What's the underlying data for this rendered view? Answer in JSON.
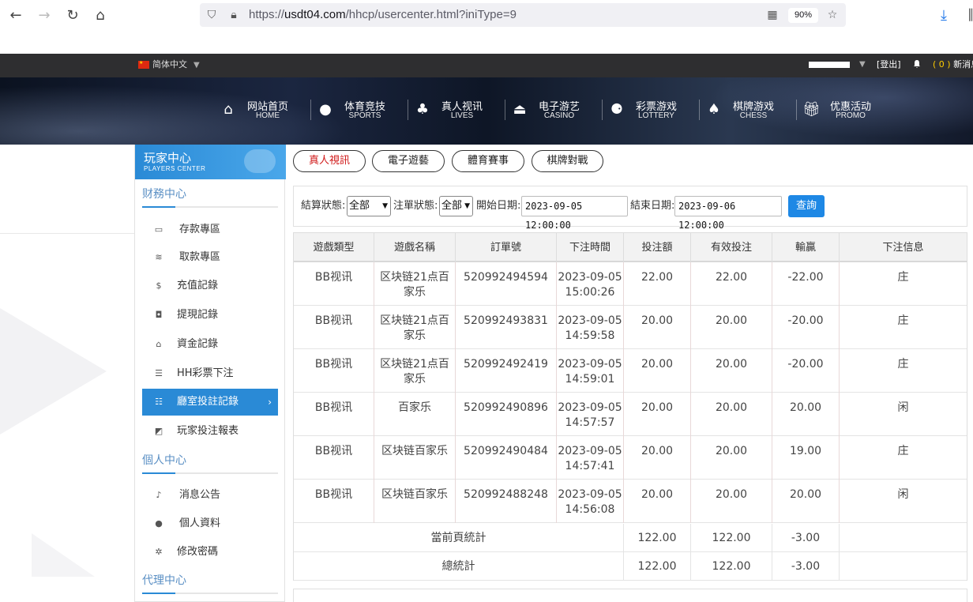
{
  "browser": {
    "url_prefix": "https://",
    "url_domain": "usdt04.com",
    "url_path": "/hhcp/usercenter.html?iniType=9",
    "zoom": "90%"
  },
  "topbar": {
    "language": "简体中文",
    "logout": "[登出]",
    "msg_count": "( 0 )",
    "msg_label": "新消息"
  },
  "nav": [
    {
      "cn": "网站首页",
      "en": "HOME",
      "icon": "home-icon"
    },
    {
      "cn": "体育竞技",
      "en": "SPORTS",
      "icon": "ball-icon"
    },
    {
      "cn": "真人视讯",
      "en": "LIVES",
      "icon": "cards-icon"
    },
    {
      "cn": "电子游艺",
      "en": "CASINO",
      "icon": "joystick-icon"
    },
    {
      "cn": "彩票游戏",
      "en": "LOTTERY",
      "icon": "lottery-balls-icon"
    },
    {
      "cn": "棋牌游戏",
      "en": "CHESS",
      "icon": "spade-icon"
    },
    {
      "cn": "优惠活动",
      "en": "PROMO",
      "icon": "gift-icon"
    }
  ],
  "sidebar": {
    "title": "玩家中心",
    "subtitle": "PLAYERS CENTER",
    "sections": [
      {
        "title": "财務中心"
      },
      {
        "title": "個人中心"
      },
      {
        "title": "代理中心"
      }
    ],
    "finance_items": [
      {
        "label": "存款專區",
        "icon": "card-icon"
      },
      {
        "label": "取款專區",
        "icon": "cash-icon"
      },
      {
        "label": "充值記錄",
        "icon": "moneybag-icon"
      },
      {
        "label": "提現記錄",
        "icon": "wallet-icon"
      },
      {
        "label": "資金記錄",
        "icon": "bank-icon"
      },
      {
        "label": "HH彩票下注",
        "icon": "list-icon"
      },
      {
        "label": "廳室投註記錄",
        "icon": "record-icon"
      },
      {
        "label": "玩家投注報表",
        "icon": "chart-icon"
      }
    ],
    "personal_items": [
      {
        "label": "消息公告",
        "icon": "bell-icon"
      },
      {
        "label": "個人資料",
        "icon": "user-icon"
      },
      {
        "label": "修改密碼",
        "icon": "gear-icon"
      }
    ]
  },
  "tabs": [
    "真人視訊",
    "電子遊藝",
    "體育賽事",
    "棋牌對戰"
  ],
  "filter": {
    "settle_label": "結算狀態:",
    "settle_value": "全部",
    "bet_label": "注單狀態:",
    "bet_value": "全部",
    "start_label": "開始日期:",
    "start_value": "2023-09-05 12:00:00",
    "end_label": "結束日期:",
    "end_value": "2023-09-06 12:00:00",
    "query": "查詢"
  },
  "table": {
    "headers": [
      "遊戲類型",
      "遊戲名稱",
      "訂單號",
      "下注時間",
      "投注額",
      "有效投注",
      "輸贏",
      "下注信息"
    ],
    "rows": [
      {
        "type": "BB视讯",
        "name": "区块链21点百家乐",
        "order": "520992494594",
        "date": "2023-09-05",
        "time": "15:00:26",
        "bet": "22.00",
        "valid": "22.00",
        "win": "-22.00",
        "info": "庄"
      },
      {
        "type": "BB视讯",
        "name": "区块链21点百家乐",
        "order": "520992493831",
        "date": "2023-09-05",
        "time": "14:59:58",
        "bet": "20.00",
        "valid": "20.00",
        "win": "-20.00",
        "info": "庄"
      },
      {
        "type": "BB视讯",
        "name": "区块链21点百家乐",
        "order": "520992492419",
        "date": "2023-09-05",
        "time": "14:59:01",
        "bet": "20.00",
        "valid": "20.00",
        "win": "-20.00",
        "info": "庄"
      },
      {
        "type": "BB视讯",
        "name": "百家乐",
        "order": "520992490896",
        "date": "2023-09-05",
        "time": "14:57:57",
        "bet": "20.00",
        "valid": "20.00",
        "win": "20.00",
        "info": "闲"
      },
      {
        "type": "BB视讯",
        "name": "区块链百家乐",
        "order": "520992490484",
        "date": "2023-09-05",
        "time": "14:57:41",
        "bet": "20.00",
        "valid": "20.00",
        "win": "19.00",
        "info": "庄"
      },
      {
        "type": "BB视讯",
        "name": "区块链百家乐",
        "order": "520992488248",
        "date": "2023-09-05",
        "time": "14:56:08",
        "bet": "20.00",
        "valid": "20.00",
        "win": "20.00",
        "info": "闲"
      }
    ],
    "page_total": {
      "label": "當前頁統計",
      "bet": "122.00",
      "valid": "122.00",
      "win": "-3.00"
    },
    "grand_total": {
      "label": "總統計",
      "bet": "122.00",
      "valid": "122.00",
      "win": "-3.00"
    }
  }
}
